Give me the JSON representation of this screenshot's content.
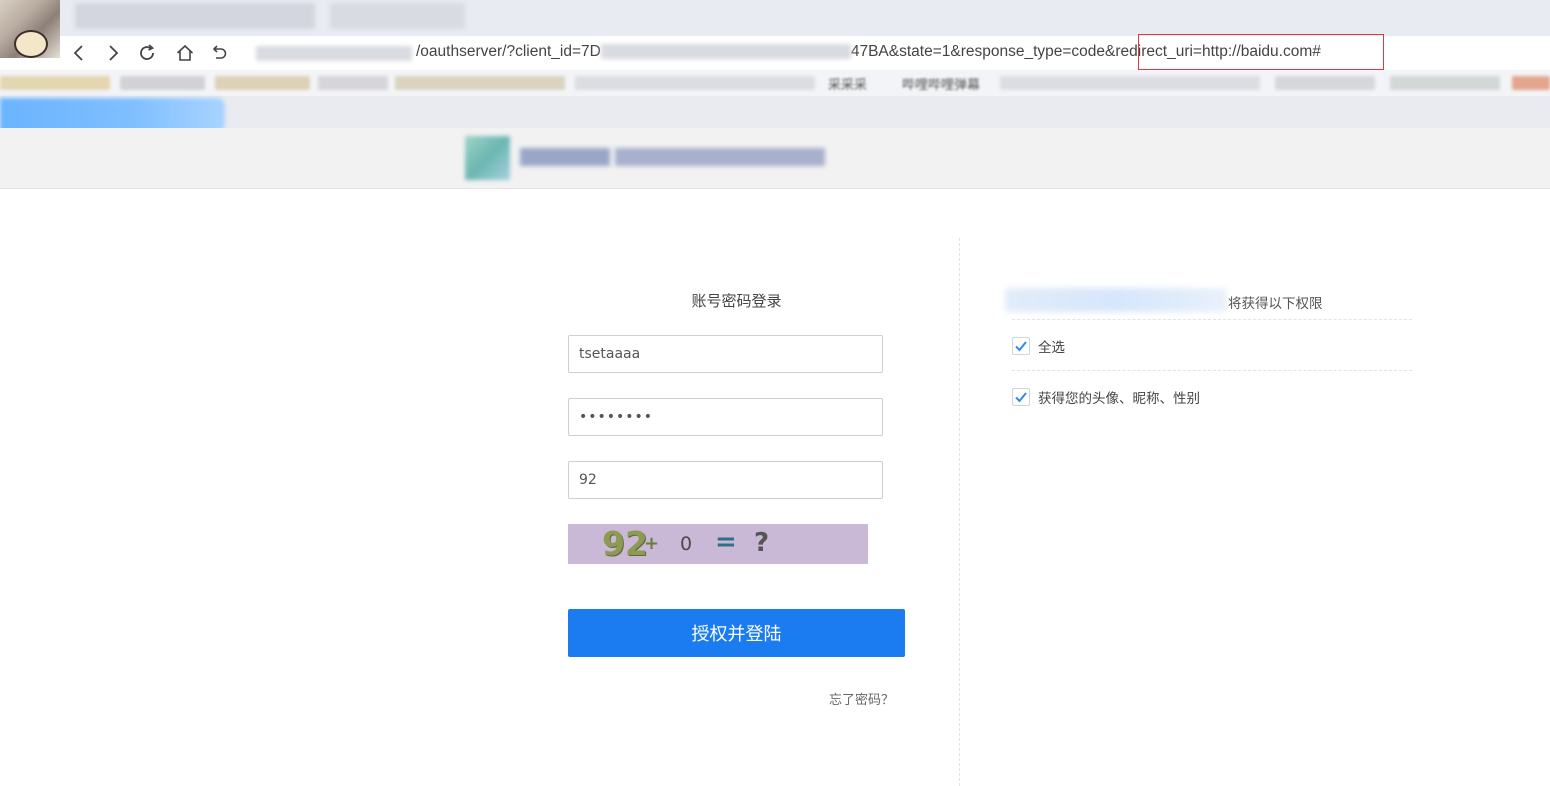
{
  "browser": {
    "url_prefix": "/oauthserver/?client_id=7D",
    "url_suffix": "47BA&state=1&response_type=code&",
    "url_highlight": "redirect_uri=http://baidu.com#",
    "bookmarks_visible": [
      "采采采",
      "哔哩哔哩弹幕"
    ]
  },
  "login": {
    "title": "账号密码登录",
    "username_value": "tsetaaaa",
    "password_value": "••••••••",
    "captcha_value": "92",
    "captcha_image": {
      "a": "92",
      "op": "+",
      "b": "0",
      "eq": "=",
      "q": "?"
    },
    "submit_label": "授权并登陆",
    "forgot_label": "忘了密码？"
  },
  "permissions": {
    "title": "将获得以下权限",
    "items": [
      {
        "label": "全选",
        "checked": true
      },
      {
        "label": "获得您的头像、昵称、性别",
        "checked": true
      }
    ]
  },
  "colors": {
    "primary": "#1a7cf0",
    "highlight_border": "#e0383e",
    "captcha_bg": "#c9b9d6"
  }
}
